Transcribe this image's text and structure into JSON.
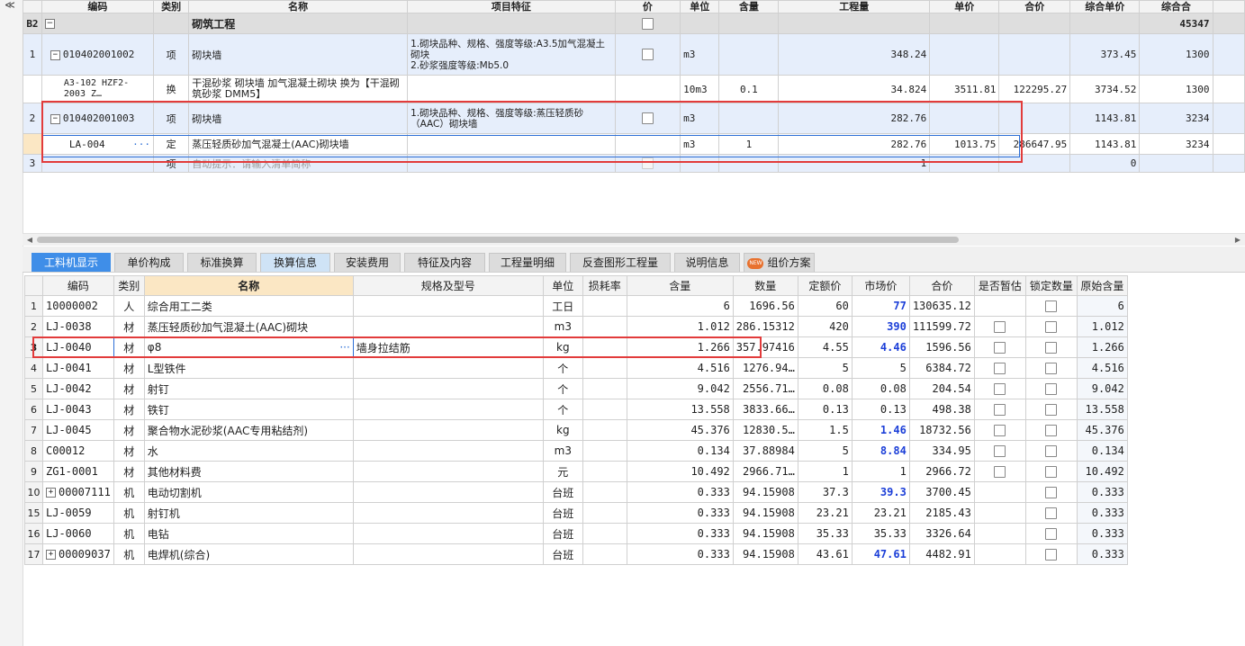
{
  "upper": {
    "headers": [
      "编码",
      "类别",
      "名称",
      "项目特征",
      "价",
      "单位",
      "含量",
      "工程量",
      "单价",
      "合价",
      "综合单价",
      "综合合"
    ],
    "collapse_glyph": "≪",
    "rows": [
      {
        "rownum": "B2",
        "code": "",
        "type": "",
        "name": "砌筑工程",
        "feature": "",
        "unit": "",
        "qty_content": "",
        "quantity": "",
        "price": "",
        "total": "",
        "composite_price": "",
        "composite_total": "45347"
      },
      {
        "rownum": "1",
        "code": "010402001002",
        "type": "项",
        "name": "砌块墙",
        "feature": "1.砌块品种、规格、强度等级:A3.5加气混凝土砌块\n2.砂浆强度等级:Mb5.0",
        "unit": "m3",
        "qty_content": "",
        "quantity": "348.24",
        "price": "",
        "total": "",
        "composite_price": "373.45",
        "composite_total": "1300"
      },
      {
        "rownum": "",
        "code": "A3-102 HZF2-2003 Z…",
        "type": "换",
        "name": "干混砂浆 砌块墙 加气混凝土砌块  换为【干混砌筑砂浆 DMM5】",
        "feature": "",
        "unit": "10m3",
        "qty_content": "0.1",
        "quantity": "34.824",
        "price": "3511.81",
        "total": "122295.27",
        "composite_price": "3734.52",
        "composite_total": "1300"
      },
      {
        "rownum": "2",
        "code": "010402001003",
        "type": "项",
        "name": "砌块墙",
        "feature": "1.砌块品种、规格、强度等级:蒸压轻质砂（AAC）砌块墙",
        "unit": "m3",
        "qty_content": "",
        "quantity": "282.76",
        "price": "",
        "total": "",
        "composite_price": "1143.81",
        "composite_total": "3234"
      },
      {
        "rownum": "",
        "code": "LA-004",
        "type": "定",
        "name": "蒸压轻质砂加气混凝土(AAC)砌块墙",
        "feature": "",
        "unit": "m3",
        "qty_content": "1",
        "quantity": "282.76",
        "price": "1013.75",
        "total": "286647.95",
        "composite_price": "1143.81",
        "composite_total": "3234"
      },
      {
        "rownum": "3",
        "code": "",
        "type": "项",
        "name": "自动提示：请输入清单简称",
        "feature": "",
        "unit": "",
        "qty_content": "",
        "quantity": "1",
        "price": "",
        "total": "",
        "composite_price": "0",
        "composite_total": ""
      }
    ]
  },
  "tabs": [
    {
      "label": "工料机显示"
    },
    {
      "label": "单价构成"
    },
    {
      "label": "标准换算"
    },
    {
      "label": "换算信息"
    },
    {
      "label": "安装费用"
    },
    {
      "label": "特征及内容"
    },
    {
      "label": "工程量明细"
    },
    {
      "label": "反查图形工程量"
    },
    {
      "label": "说明信息"
    },
    {
      "label": "组价方案",
      "badge": "NEW"
    }
  ],
  "lower": {
    "headers": [
      "",
      "编码",
      "类别",
      "名称",
      "规格及型号",
      "单位",
      "损耗率",
      "含量",
      "数量",
      "定额价",
      "市场价",
      "合价",
      "是否暂估",
      "锁定数量",
      "原始含量"
    ],
    "rows": [
      {
        "rn": "1",
        "code": "10000002",
        "type": "人",
        "name": "综合用工二类",
        "spec": "",
        "unit": "工日",
        "loss": "",
        "content": "6",
        "qty": "1696.56",
        "quota": "60",
        "market": "77",
        "total": "130635.12",
        "orig": "6",
        "has_cb": false
      },
      {
        "rn": "2",
        "code": "LJ-0038",
        "type": "材",
        "name": "蒸压轻质砂加气混凝土(AAC)砌块",
        "spec": "",
        "unit": "m3",
        "loss": "",
        "content": "1.012",
        "qty": "286.15312",
        "quota": "420",
        "market": "390",
        "total": "111599.72",
        "orig": "1.012",
        "has_cb": true
      },
      {
        "rn": "3",
        "code": "LJ-0040",
        "type": "材",
        "name": "φ8",
        "spec": "墙身拉结筋",
        "unit": "kg",
        "loss": "",
        "content": "1.266",
        "qty": "357.97416",
        "quota": "4.55",
        "market": "4.46",
        "total": "1596.56",
        "orig": "1.266",
        "has_cb": true
      },
      {
        "rn": "4",
        "code": "LJ-0041",
        "type": "材",
        "name": "L型铁件",
        "spec": "",
        "unit": "个",
        "loss": "",
        "content": "4.516",
        "qty": "1276.94…",
        "quota": "5",
        "market": "5",
        "total": "6384.72",
        "orig": "4.516",
        "has_cb": true
      },
      {
        "rn": "5",
        "code": "LJ-0042",
        "type": "材",
        "name": "射钉",
        "spec": "",
        "unit": "个",
        "loss": "",
        "content": "9.042",
        "qty": "2556.71…",
        "quota": "0.08",
        "market": "0.08",
        "total": "204.54",
        "orig": "9.042",
        "has_cb": true
      },
      {
        "rn": "6",
        "code": "LJ-0043",
        "type": "材",
        "name": "铁钉",
        "spec": "",
        "unit": "个",
        "loss": "",
        "content": "13.558",
        "qty": "3833.66…",
        "quota": "0.13",
        "market": "0.13",
        "total": "498.38",
        "orig": "13.558",
        "has_cb": true
      },
      {
        "rn": "7",
        "code": "LJ-0045",
        "type": "材",
        "name": "聚合物水泥砂浆(AAC专用粘结剂)",
        "spec": "",
        "unit": "kg",
        "loss": "",
        "content": "45.376",
        "qty": "12830.5…",
        "quota": "1.5",
        "market": "1.46",
        "total": "18732.56",
        "orig": "45.376",
        "has_cb": true
      },
      {
        "rn": "8",
        "code": "C00012",
        "type": "材",
        "name": "水",
        "spec": "",
        "unit": "m3",
        "loss": "",
        "content": "0.134",
        "qty": "37.88984",
        "quota": "5",
        "market": "8.84",
        "total": "334.95",
        "orig": "0.134",
        "has_cb": true
      },
      {
        "rn": "9",
        "code": "ZG1-0001",
        "type": "材",
        "name": "其他材料费",
        "spec": "",
        "unit": "元",
        "loss": "",
        "content": "10.492",
        "qty": "2966.71…",
        "quota": "1",
        "market": "1",
        "total": "2966.72",
        "orig": "10.492",
        "has_cb": true
      },
      {
        "rn": "10",
        "code": "00007111",
        "type": "机",
        "name": "电动切割机",
        "spec": "",
        "unit": "台班",
        "loss": "",
        "content": "0.333",
        "qty": "94.15908",
        "quota": "37.3",
        "market": "39.3",
        "total": "3700.45",
        "orig": "0.333",
        "has_cb": false,
        "expand": true
      },
      {
        "rn": "15",
        "code": "LJ-0059",
        "type": "机",
        "name": "射钉机",
        "spec": "",
        "unit": "台班",
        "loss": "",
        "content": "0.333",
        "qty": "94.15908",
        "quota": "23.21",
        "market": "23.21",
        "total": "2185.43",
        "orig": "0.333",
        "has_cb": false
      },
      {
        "rn": "16",
        "code": "LJ-0060",
        "type": "机",
        "name": "电钻",
        "spec": "",
        "unit": "台班",
        "loss": "",
        "content": "0.333",
        "qty": "94.15908",
        "quota": "35.33",
        "market": "35.33",
        "total": "3326.64",
        "orig": "0.333",
        "has_cb": false
      },
      {
        "rn": "17",
        "code": "00009037",
        "type": "机",
        "name": "电焊机(综合)",
        "spec": "",
        "unit": "台班",
        "loss": "",
        "content": "0.333",
        "qty": "94.15908",
        "quota": "43.61",
        "market": "47.61",
        "total": "4482.91",
        "orig": "0.333",
        "has_cb": false,
        "expand": true
      }
    ],
    "blue_market_rows": [
      0,
      1,
      2,
      6,
      7,
      9,
      12
    ]
  },
  "colors": {
    "accent": "#3f8ee8",
    "highlight_box": "#e23b3b",
    "blue_value": "#1c3fd8"
  }
}
